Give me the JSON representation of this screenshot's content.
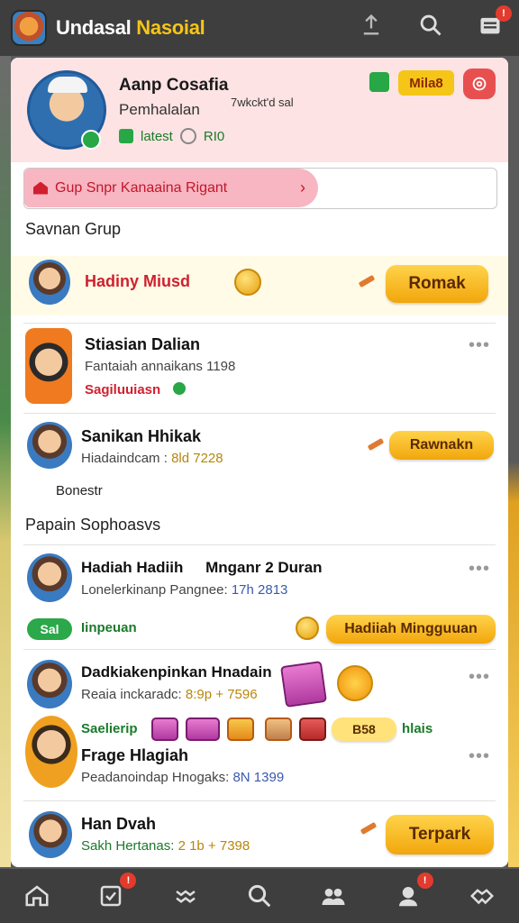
{
  "app": {
    "title_part1": "Undasal ",
    "title_part2": "Nasoial"
  },
  "topbar": {
    "notification_count": "!"
  },
  "profile": {
    "name": "Aanp Cosafia",
    "subtitle": "Pemhalalan",
    "subtitle2": "7wkckt'd sal",
    "latest": "latest",
    "stat": "RI0",
    "badge": "Mila8"
  },
  "banner": {
    "text": "Gup Snpr Kanaaina Rigant",
    "chevron": "›"
  },
  "sections": {
    "group": "Savnan Grup",
    "popular": "Papain Sophoasvs"
  },
  "rows": [
    {
      "title": "Hadiny Miusd",
      "button": "Romak"
    },
    {
      "title": "Stiasian Dalian",
      "sub": "Fantaiah annaikans 1198",
      "sub2": "Sagiluuiasn",
      "dots": "•••"
    },
    {
      "title": "Sanikan Hhikak",
      "sub": "Hiadaindcam : ",
      "sub_num": "8ld 7228",
      "button": "Rawnakn",
      "extra": "Bonestr",
      "dots": ""
    },
    {
      "title": "Hadiah Hadiih",
      "title2": "Mnganr 2 Duran",
      "sub": "Lonelerkinanp Pangnee: ",
      "sub_num": "17h 2813",
      "pill": "Sal",
      "pill_text": "Iinpeuan",
      "button": "Hadiiah Mingguuan",
      "dots": "•••"
    },
    {
      "title": "Dadkiakenpinkan Hnadain",
      "sub": "Reaia inckaradc: ",
      "sub_num": "8:9p + 7596",
      "extra": "Saelierip",
      "gift_label": "B58",
      "gift_label2": "hlais",
      "dots": "•••"
    },
    {
      "title": "Frage Hlagiah",
      "sub": "Peadanoindap Hnogaks: ",
      "sub_num": "8N 1399",
      "dots": "•••"
    },
    {
      "title": "Han Dvah",
      "sub": "Sakh Hertanas: ",
      "sub_num": "2 1b + 7398",
      "button": "Terpark"
    }
  ],
  "colors": {
    "topbar": "#3e3e3e",
    "gold": "#f5c518",
    "green": "#27a745",
    "red": "#e23b2e",
    "profile_bg": "#fde3e3"
  },
  "icons": [
    "app-logo",
    "upload-icon",
    "search-icon",
    "inbox-icon",
    "home-icon",
    "tasks-icon",
    "chart-icon",
    "search-icon",
    "group-icon",
    "friends-icon",
    "handshake-icon"
  ]
}
